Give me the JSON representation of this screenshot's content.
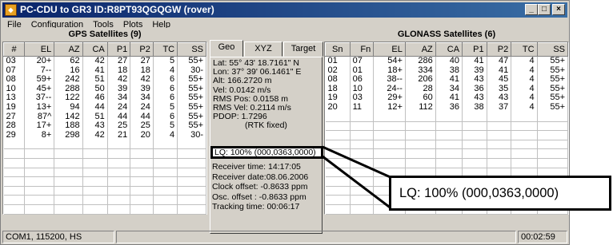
{
  "window": {
    "title": "PC-CDU to GR3 ID:R8PT93QGQGW (rover)",
    "minimize": "_",
    "maximize": "□",
    "close": "×"
  },
  "menu": [
    "File",
    "Configuration",
    "Tools",
    "Plots",
    "Help"
  ],
  "gps": {
    "title": "GPS Satellites (9)",
    "columns": [
      "#",
      "EL",
      "AZ",
      "CA",
      "P1",
      "P2",
      "TC",
      "SS"
    ],
    "rows": [
      [
        "03",
        "20+",
        "62",
        "42",
        "27",
        "27",
        "5",
        "55+"
      ],
      [
        "07",
        "7--",
        "16",
        "41",
        "18",
        "18",
        "4",
        "30-"
      ],
      [
        "08",
        "59+",
        "242",
        "51",
        "42",
        "42",
        "6",
        "55+"
      ],
      [
        "10",
        "45+",
        "288",
        "50",
        "39",
        "39",
        "6",
        "55+"
      ],
      [
        "13",
        "37--",
        "122",
        "46",
        "34",
        "34",
        "6",
        "55+"
      ],
      [
        "19",
        "13+",
        "94",
        "44",
        "24",
        "24",
        "5",
        "55+"
      ],
      [
        "27",
        "87^",
        "142",
        "51",
        "44",
        "44",
        "6",
        "55+"
      ],
      [
        "28",
        "17+",
        "188",
        "43",
        "25",
        "25",
        "5",
        "55+"
      ],
      [
        "29",
        "8+",
        "298",
        "42",
        "21",
        "20",
        "4",
        "30-"
      ]
    ]
  },
  "glonass": {
    "title": "GLONASS Satellites (6)",
    "columns": [
      "Sn",
      "Fn",
      "EL",
      "AZ",
      "CA",
      "P1",
      "P2",
      "TC",
      "SS"
    ],
    "rows": [
      [
        "01",
        "07",
        "54+",
        "286",
        "40",
        "41",
        "47",
        "4",
        "55+"
      ],
      [
        "02",
        "01",
        "18+",
        "334",
        "38",
        "39",
        "41",
        "4",
        "55+"
      ],
      [
        "08",
        "06",
        "38--",
        "206",
        "41",
        "43",
        "45",
        "4",
        "55+"
      ],
      [
        "18",
        "10",
        "24--",
        "28",
        "34",
        "36",
        "35",
        "4",
        "55+"
      ],
      [
        "19",
        "03",
        "29+",
        "60",
        "41",
        "43",
        "43",
        "4",
        "55+"
      ],
      [
        "20",
        "11",
        "12+",
        "112",
        "36",
        "38",
        "37",
        "4",
        "55+"
      ]
    ]
  },
  "tabs": [
    "Geo",
    "XYZ",
    "Target"
  ],
  "geo": [
    "Lat:  55° 43' 18.7161\" N",
    "Lon: 37° 39' 06.1461\" E",
    "Alt:  166.2720 m",
    "Vel:  0.0142 m/s",
    "RMS Pos:  0.0158 m",
    "RMS Vel:  0.2114 m/s",
    "PDOP:  1.7296",
    "(RTK fixed)"
  ],
  "lq": "LQ: 100% (000,0363,0000)",
  "receiver": [
    "Receiver time: 14:17:05",
    "Receiver date:08.06.2006",
    "Clock offset:  -0.8633 ppm",
    "Osc. offset :  -0.8633 ppm",
    "Tracking time: 00:06:17"
  ],
  "status": {
    "port": "COM1, 115200, HS",
    "timer": "00:02:59"
  },
  "callout": "LQ: 100% (000,0363,0000)"
}
